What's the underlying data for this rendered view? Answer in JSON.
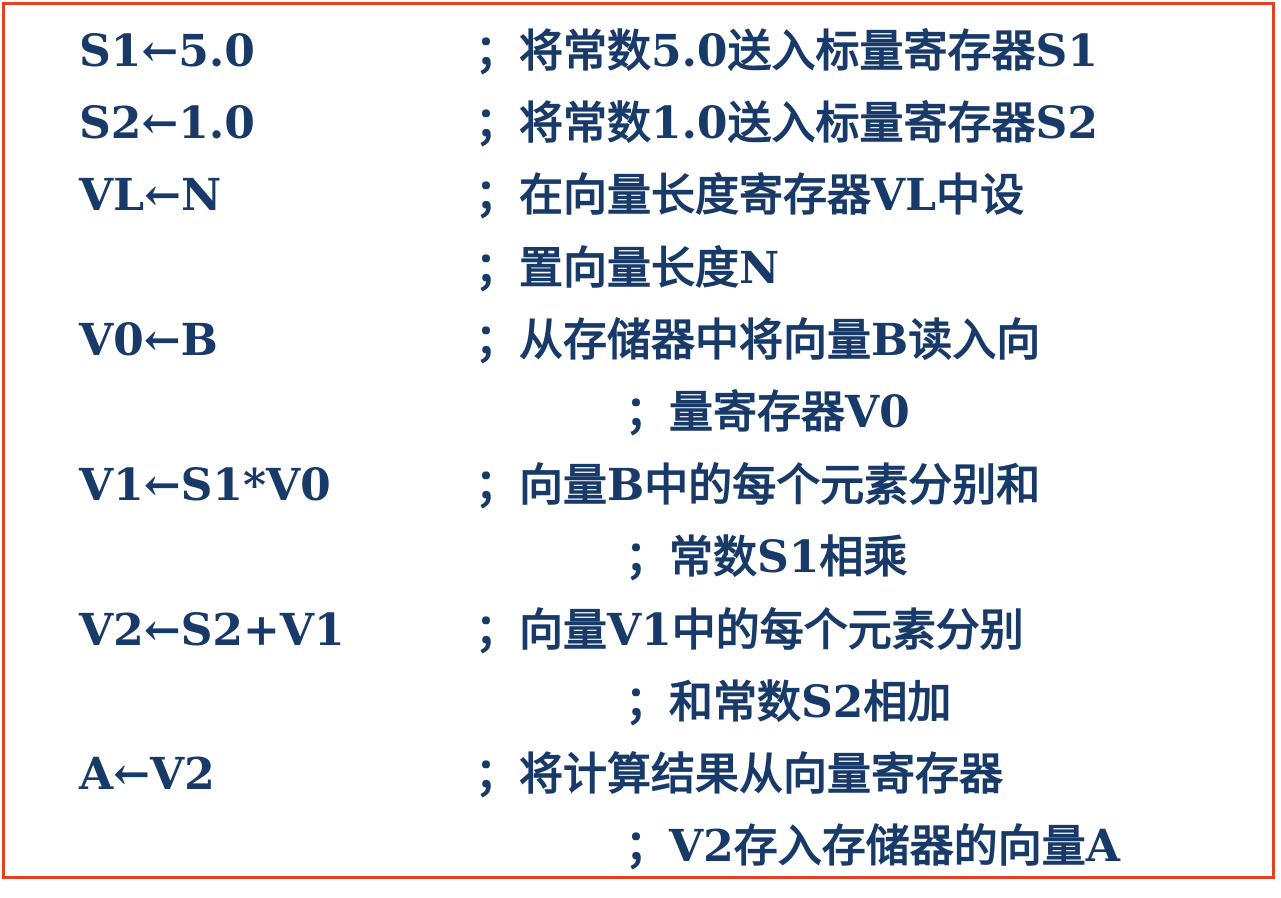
{
  "code_lines": [
    {
      "instr": "S1←5.0",
      "comment": "；将常数5.0送入标量寄存器S1"
    },
    {
      "instr": "S2←1.0",
      "comment": "；将常数1.0送入标量寄存器S2"
    },
    {
      "instr": "VL←N",
      "comment": "；在向量长度寄存器VL中设"
    },
    {
      "instr": "",
      "comment": "；置向量长度N"
    },
    {
      "instr": "V0←B",
      "comment": "；从存储器中将向量B读入向"
    },
    {
      "instr": "",
      "comment": "；量寄存器V0"
    },
    {
      "instr": "V1←S1*V0",
      "comment": "；向量B中的每个元素分别和"
    },
    {
      "instr": "",
      "comment": "；常数S1相乘"
    },
    {
      "instr": "V2←S2+V1",
      "comment": "；向量V1中的每个元素分别"
    },
    {
      "instr": "",
      "comment": "；和常数S2相加"
    },
    {
      "instr": "A←V2",
      "comment": "；将计算结果从向量寄存器"
    },
    {
      "instr": "",
      "comment": "；V2存入存储器的向量A"
    }
  ],
  "colors": {
    "text": "#173a69",
    "border": "#e8401e",
    "background": "#ffffff"
  }
}
